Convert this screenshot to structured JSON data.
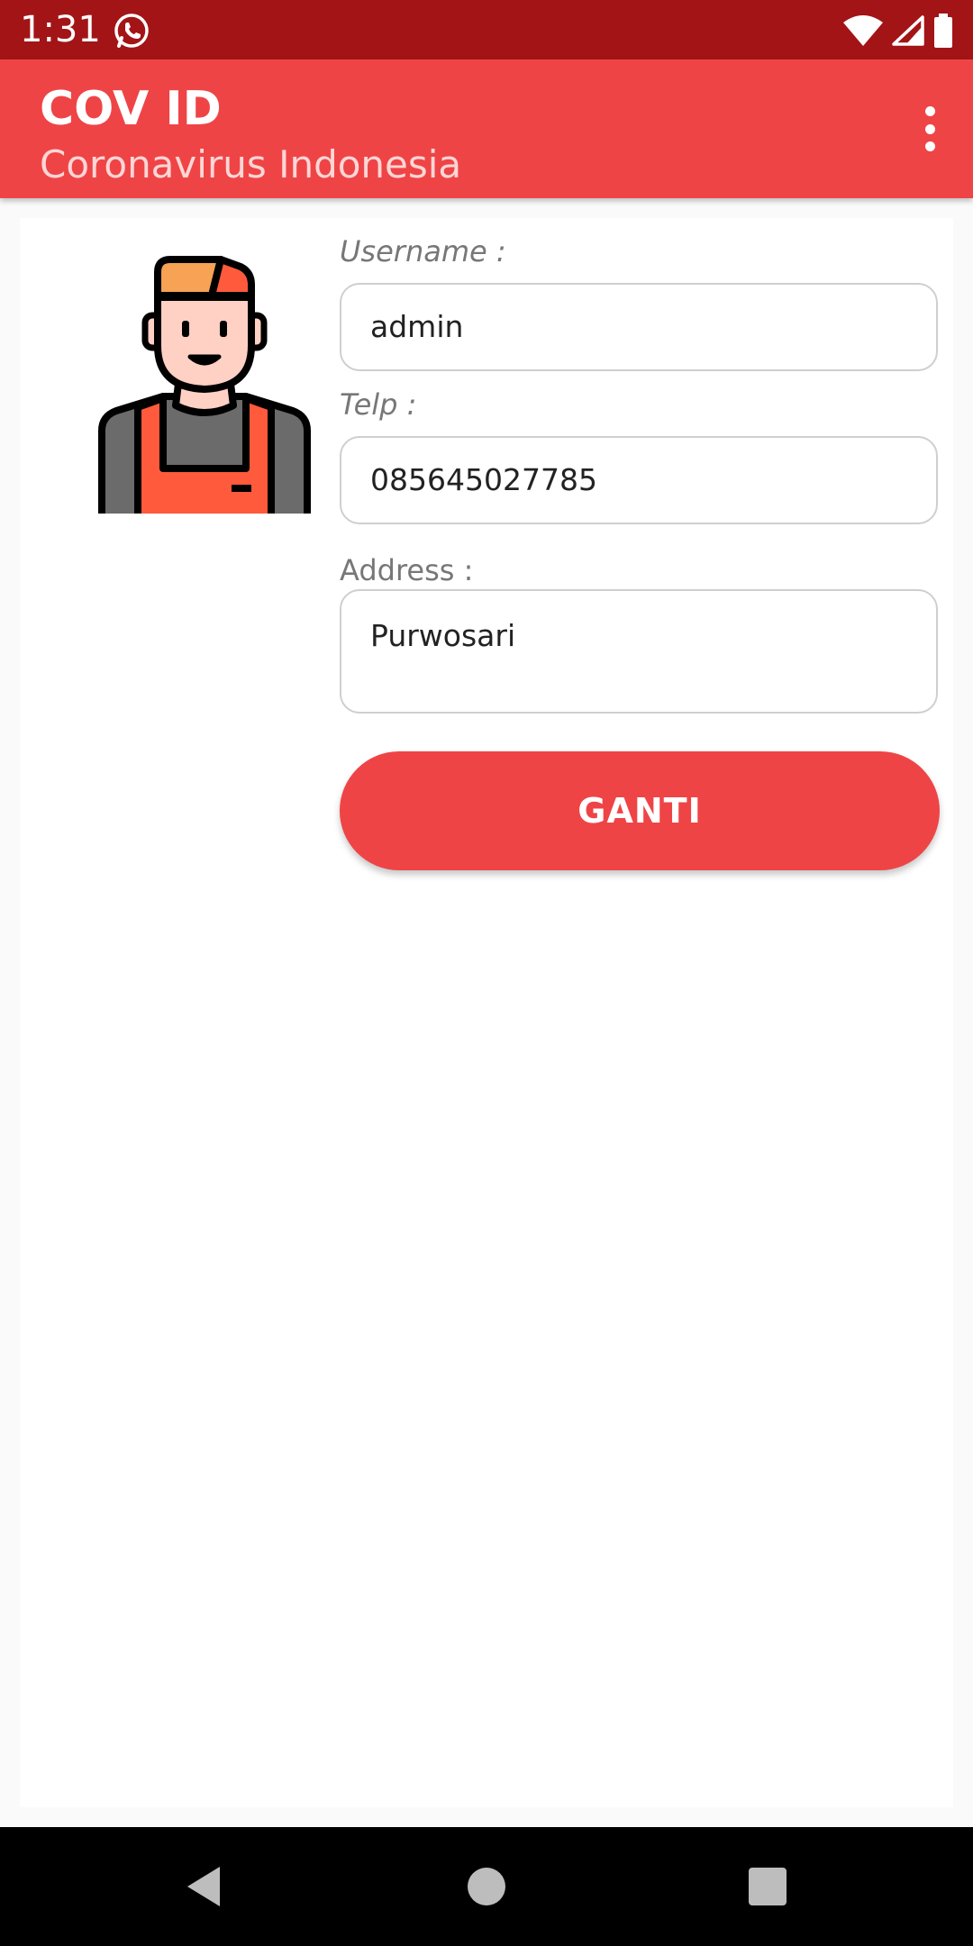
{
  "status_bar": {
    "time": "1:31",
    "notification_icon": "whatsapp-icon",
    "right_icons": [
      "wifi-icon",
      "signal-icon",
      "battery-icon"
    ]
  },
  "app_bar": {
    "title": "COV ID",
    "subtitle": "Coronavirus Indonesia",
    "menu_icon": "overflow-menu-icon"
  },
  "profile": {
    "avatar_icon": "user-avatar-icon",
    "username_label": "Username :",
    "username_value": "admin",
    "telp_label": "Telp :",
    "telp_value": "085645027785",
    "address_label": "Address :",
    "address_value": "Purwosari",
    "submit_label": "GANTI"
  },
  "navigation": {
    "back_icon": "back-icon",
    "home_icon": "home-icon",
    "recents_icon": "recents-icon"
  },
  "colors": {
    "status_bar": "#a31417",
    "primary": "#ef4446",
    "subtitle": "#ffd6d6"
  }
}
